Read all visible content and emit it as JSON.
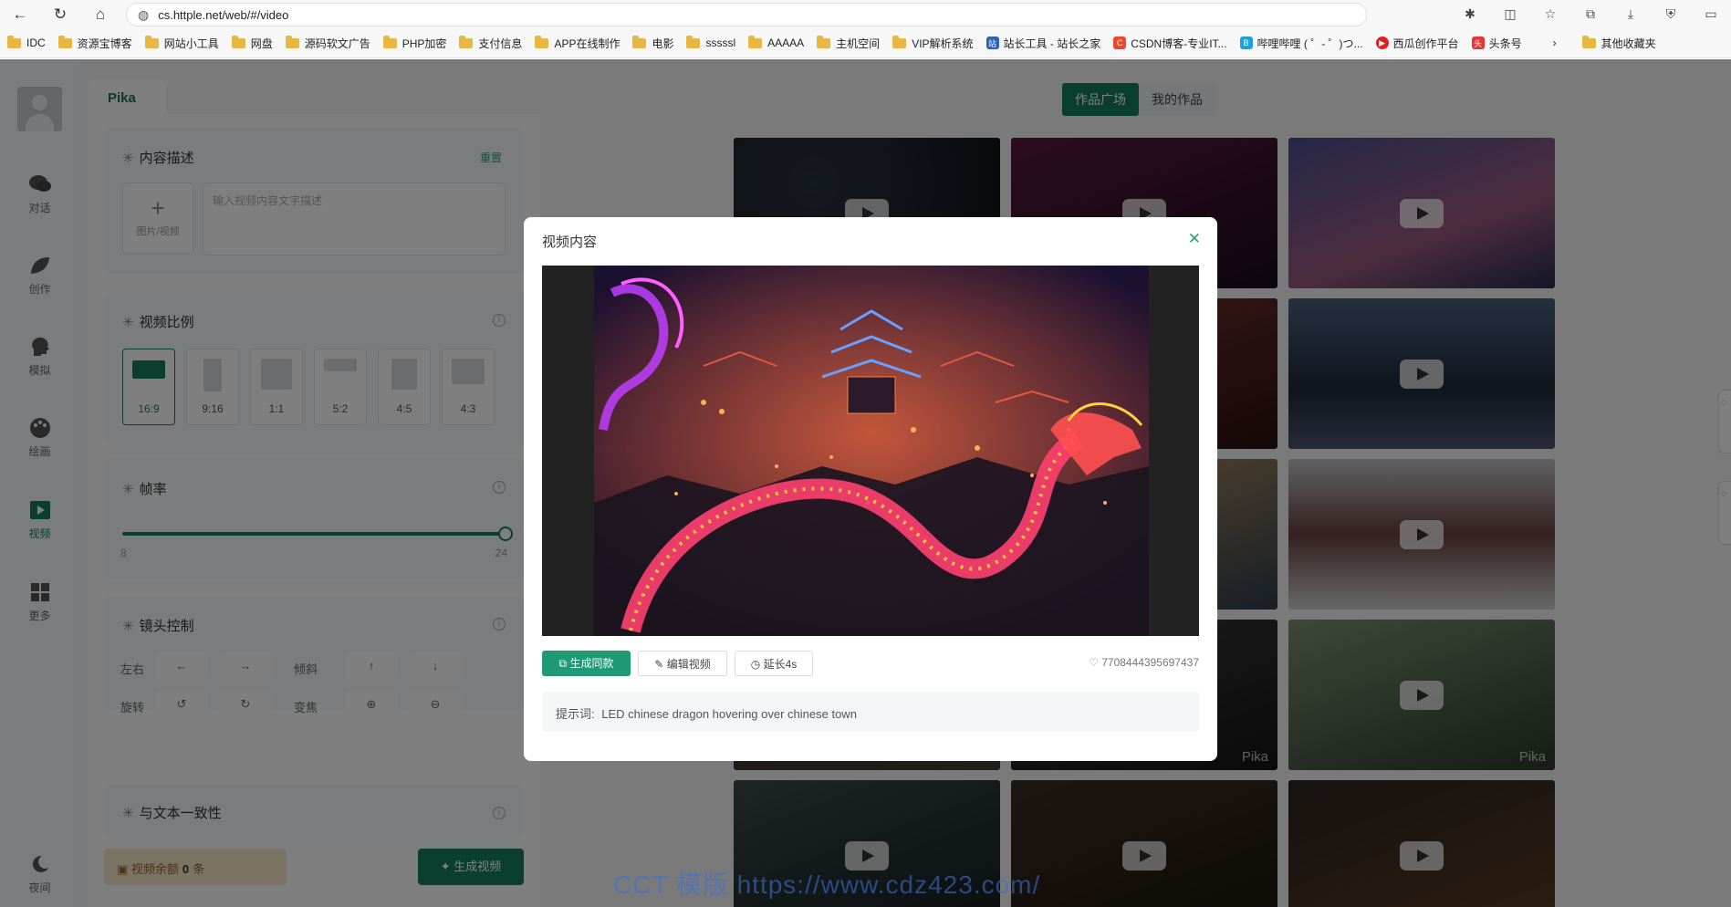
{
  "browser": {
    "url": "cs.httple.net/web/#/video",
    "bookmarks": [
      "IDC",
      "资源宝博客",
      "网站小工具",
      "网盘",
      "源码软文广告",
      "PHP加密",
      "支付信息",
      "APP在线制作",
      "电影",
      "sssssl",
      "AAAAA",
      "主机空间",
      "VIP解析系统",
      "站长工具 - 站长之家",
      "CSDN博客-专业IT...",
      "哔哩哔哩 ( ゜- ゜)つ...",
      "西瓜创作平台",
      "头条号",
      "其他收藏夹"
    ]
  },
  "nav": {
    "items": [
      {
        "label": "对话",
        "icon": "chat-icon"
      },
      {
        "label": "创作",
        "icon": "leaf-icon"
      },
      {
        "label": "模拟",
        "icon": "head-icon"
      },
      {
        "label": "绘画",
        "icon": "palette-icon"
      },
      {
        "label": "视频",
        "icon": "video-icon"
      },
      {
        "label": "更多",
        "icon": "grid-icon"
      }
    ],
    "night_label": "夜间"
  },
  "panel": {
    "tab": "Pika",
    "content_title": "内容描述",
    "reset_label": "重置",
    "upload_label": "图片/视频",
    "desc_placeholder": "输入视频内容文字描述",
    "ratio_title": "视频比例",
    "ratios": [
      "16:9",
      "9:16",
      "1:1",
      "5:2",
      "4:5",
      "4:3"
    ],
    "selected_ratio": "16:9",
    "fps_title": "帧率",
    "fps_min": "8",
    "fps_max": "24",
    "fps_value": 24,
    "camera_title": "镜头控制",
    "camera_rows": [
      {
        "label": "左右",
        "btn1": "←",
        "btn2": "→",
        "label2": "倾斜",
        "btn3": "↑",
        "btn4": "↓"
      },
      {
        "label": "旋转",
        "btn1": "↺",
        "btn2": "↻",
        "label2": "变焦",
        "btn3": "⊕",
        "btn4": "⊖"
      }
    ],
    "consistency_title": "与文本一致性",
    "balance_label": "视频余额",
    "balance_value": "0",
    "balance_unit": "条",
    "generate_label": "✦ 生成视频"
  },
  "gallery": {
    "tabs": [
      "作品广场",
      "我的作品"
    ],
    "watermark": "Pika"
  },
  "modal": {
    "title": "视频内容",
    "btn_same": "生成同款",
    "btn_edit": "编辑视频",
    "btn_extend": "延长4s",
    "video_id": "7708444395697437",
    "prompt_label": "提示词:",
    "prompt": "LED chinese dragon hovering over chinese town"
  },
  "site_watermark": "CCT 模版 https://www.cdz423.com/",
  "colors": {
    "accent": "#157e5e",
    "accent_light": "#1f9a74"
  }
}
